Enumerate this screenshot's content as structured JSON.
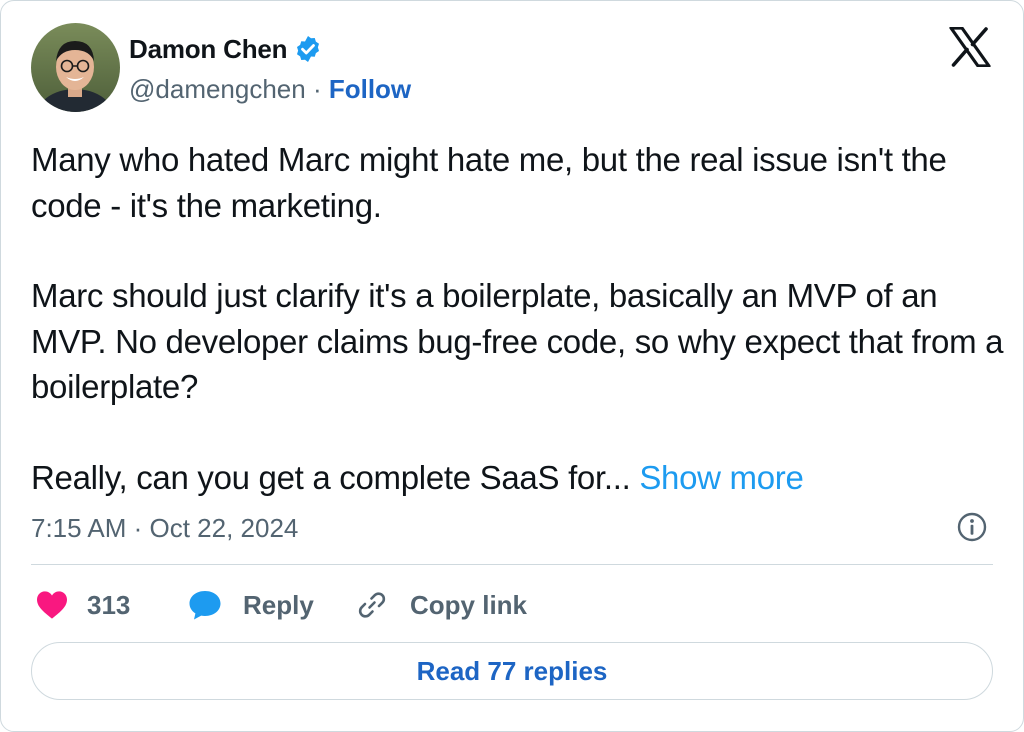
{
  "author": {
    "name": "Damon Chen",
    "handle": "@damengchen",
    "separator": " · ",
    "follow_label": "Follow",
    "verified": true
  },
  "tweet": {
    "paragraphs": [
      "Many who hated Marc might hate me, but the real issue isn't the code - it's the marketing.",
      "Marc should just clarify it's a boilerplate, basically an MVP of an MVP. No developer claims bug-free code, so why expect that from a boilerplate?",
      "Really, can you get a complete SaaS for..."
    ],
    "show_more_label": "Show more",
    "timestamp": "7:15 AM · Oct 22, 2024"
  },
  "actions": {
    "like_count": "313",
    "reply_label": "Reply",
    "copy_link_label": "Copy link"
  },
  "read_replies_label": "Read 77 replies",
  "icons": {
    "x_logo": "x-logo-icon",
    "verified": "verified-badge-icon",
    "like": "heart-icon",
    "reply": "speech-bubble-icon",
    "copy_link": "link-icon",
    "info": "info-icon"
  },
  "colors": {
    "accent": "#1d9bf0",
    "link": "#1d65c4",
    "like": "#f91880",
    "muted": "#536471",
    "border": "#cfd9de",
    "text": "#0f1419"
  }
}
